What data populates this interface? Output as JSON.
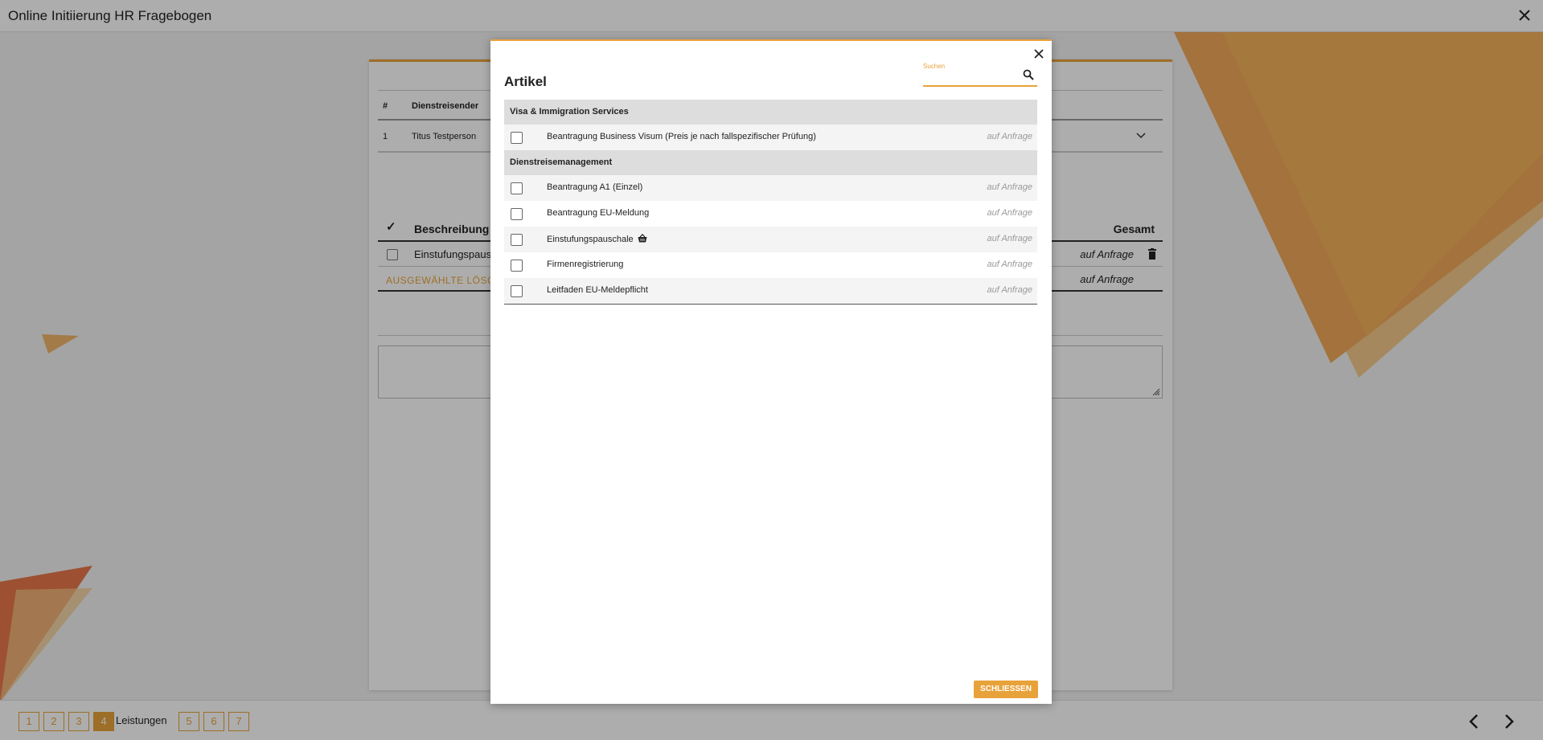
{
  "window": {
    "title": "Online Initiierung HR Fragebogen"
  },
  "travelers_table": {
    "headers": [
      "#",
      "Dienstreisender"
    ],
    "rows": [
      {
        "index": "1",
        "name": "Titus Testperson"
      }
    ]
  },
  "services_table": {
    "headers": {
      "description": "Beschreibung",
      "total": "Gesamt"
    },
    "rows": [
      {
        "description": "Einstufungspauschale",
        "total": "auf Anfrage"
      }
    ],
    "delete_selected": "AUSGEWÄHLTE LÖSCHEN",
    "sum_total": "auf Anfrage"
  },
  "steps": {
    "items": [
      "1",
      "2",
      "3",
      "4",
      "5",
      "6",
      "7"
    ],
    "active": "4",
    "active_label": "Leistungen"
  },
  "modal": {
    "title": "Artikel",
    "search": {
      "label": "Suchen",
      "value": ""
    },
    "groups": [
      {
        "name": "Visa & Immigration Services",
        "items": [
          {
            "name": "Beantragung Business Visum (Preis je nach fallspezifischer Prüfung)",
            "price": "auf Anfrage",
            "in_basket": false
          }
        ]
      },
      {
        "name": "Dienstreisemanagement",
        "items": [
          {
            "name": "Beantragung A1 (Einzel)",
            "price": "auf Anfrage",
            "in_basket": false
          },
          {
            "name": "Beantragung EU-Meldung",
            "price": "auf Anfrage",
            "in_basket": false
          },
          {
            "name": "Einstufungspauschale",
            "price": "auf Anfrage",
            "in_basket": true
          },
          {
            "name": "Firmenregistrierung",
            "price": "auf Anfrage",
            "in_basket": false
          },
          {
            "name": "Leitfaden EU-Meldepflicht",
            "price": "auf Anfrage",
            "in_basket": false
          }
        ]
      }
    ],
    "close_button": "SCHLIESSEN"
  },
  "colors": {
    "accent": "#e8a23a"
  }
}
